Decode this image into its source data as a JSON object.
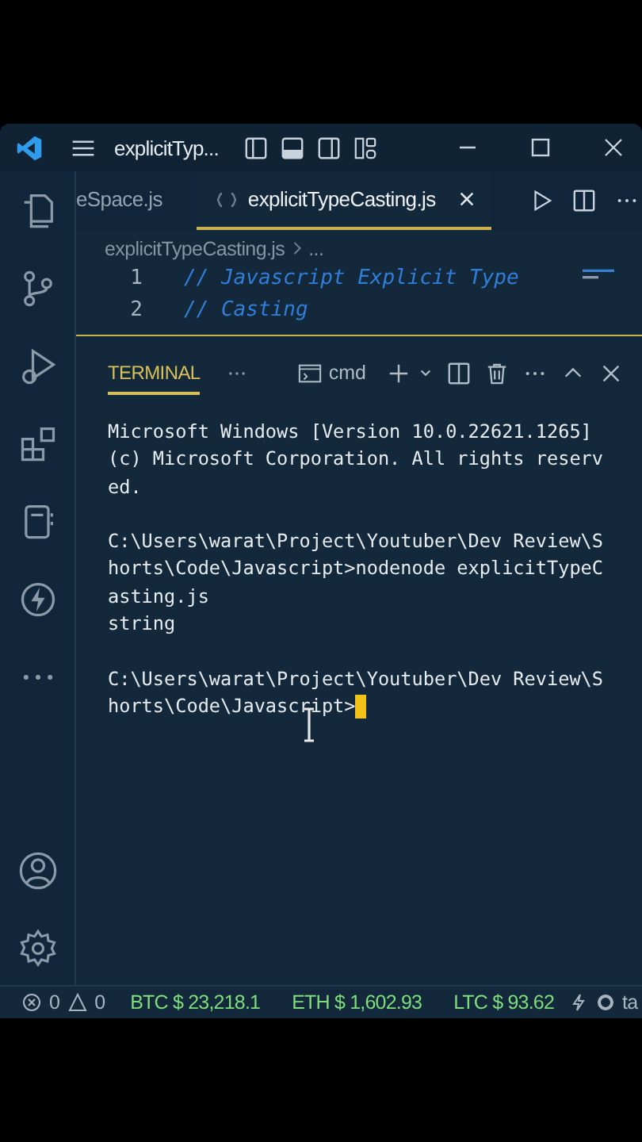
{
  "window": {
    "title": "explicitTyp..."
  },
  "tabs": [
    {
      "label": "eSpace.js",
      "selected": false
    },
    {
      "label": "explicitTypeCasting.js",
      "selected": true
    }
  ],
  "breadcrumb": {
    "file": "explicitTypeCasting.js",
    "rest": "..."
  },
  "code_lines": [
    {
      "number": "1",
      "text": "// Javascript Explicit Type"
    },
    {
      "number": "2",
      "text": "// Casting"
    }
  ],
  "panel": {
    "tabs": [
      {
        "label": "TERMINAL",
        "selected": true
      }
    ],
    "shell": "cmd"
  },
  "terminal": {
    "cursor": true,
    "blocks": [
      [
        "Microsoft Windows [Version 10.0.22621.1265]",
        "(c) Microsoft Corporation. All rights reserv",
        "ed."
      ],
      [
        "C:\\Users\\warat\\Project\\Youtuber\\Dev Review\\S",
        "horts\\Code\\Javascript>nodenode explicitTypeC",
        "asting.js",
        "string"
      ],
      [
        "C:\\Users\\warat\\Project\\Youtuber\\Dev Review\\S",
        "horts\\Code\\Javascript>"
      ]
    ]
  },
  "status_bar": {
    "errors": "0",
    "warnings": "0",
    "prices": [
      "BTC $ 23,218.1",
      "ETH $ 1,602.93",
      "LTC $ 93.62"
    ],
    "last": "ta"
  }
}
